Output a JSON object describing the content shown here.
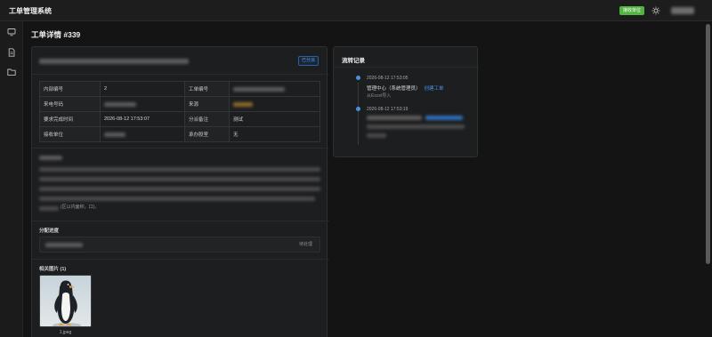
{
  "app": {
    "title": "工单管理系统"
  },
  "header": {
    "badge": "接收单位"
  },
  "page": {
    "title": "工单详情 #339"
  },
  "ticket": {
    "status": "已分派",
    "rows": [
      {
        "label1": "内部编号",
        "value1": "2",
        "label2": "工单编号",
        "value2": ""
      },
      {
        "label1": "来电号码",
        "value1": "",
        "label2": "来源",
        "value2": ""
      },
      {
        "label1": "要求完成时间",
        "value1": "2026-08-12 17:53:07",
        "label2": "分派备注",
        "value2": "测试"
      },
      {
        "label1": "接收单位",
        "value1": "",
        "label2": "承办股室",
        "value2": "无"
      }
    ],
    "content_fragment": "(区以内面积，口)。"
  },
  "assignment": {
    "title": "分配进度",
    "status": "待处理"
  },
  "images": {
    "title": "相关图片 (1)",
    "files": [
      {
        "name": "1.jpeg"
      }
    ]
  },
  "flow": {
    "title": "流转记录",
    "entries": [
      {
        "time": "2026-08-12 17:53:05",
        "actor": "管理中心（系统管理员）",
        "action": "创建工单",
        "note": "从Excel导入"
      },
      {
        "time": "2026-08-12 17:53:19",
        "actor": "",
        "action": "",
        "note": ""
      }
    ]
  },
  "colors": {
    "accent": "#4a90e2",
    "success": "#52b441",
    "danger": "#ef4d4d",
    "warning": "#e6a23c"
  },
  "icons": {
    "header": [
      "sun-icon"
    ],
    "sidebar": [
      "monitor-icon",
      "document-icon",
      "folder-icon"
    ]
  }
}
